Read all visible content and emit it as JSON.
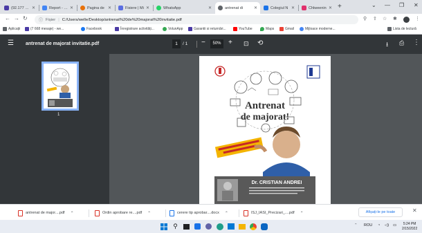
{
  "tabs": [
    {
      "label": "(92.177 unr",
      "favicon_color": "#4a3aa5",
      "icon": "mail-icon"
    },
    {
      "label": "Report - ac",
      "favicon_color": "#4285f4",
      "icon": "doc-icon"
    },
    {
      "label": "Pagina de",
      "favicon_color": "#e8710a",
      "icon": "page-icon"
    },
    {
      "label": "Fisiere | Mi",
      "favicon_color": "#5b6ee1",
      "icon": "folder-icon"
    },
    {
      "label": "WhatsApp",
      "favicon_color": "#25d366",
      "icon": "whatsapp-icon"
    },
    {
      "label": "antrenat di",
      "favicon_color": "#5f6368",
      "icon": "globe-icon"
    },
    {
      "label": "Colegiul N",
      "favicon_color": "#1a73e8",
      "icon": "school-icon"
    },
    {
      "label": "Chlweenin",
      "favicon_color": "#e1306c",
      "icon": "instagram-icon"
    }
  ],
  "active_tab_index": 5,
  "omnibox": {
    "label": "Fișier",
    "url": "C:/Users/welle/Desktop/antrenat%20de%20majorat%20invitatie.pdf"
  },
  "bookmarks": [
    {
      "label": "Aplicații",
      "color": "#5f6368"
    },
    {
      "label": "(7 668 mesaje) - we...",
      "color": "#4a3aa5"
    },
    {
      "label": "Facebook",
      "color": "#1877f2"
    },
    {
      "label": "Înregistrare activități...",
      "color": "#4a3aa5"
    },
    {
      "label": "VolunApp",
      "color": "#34a853"
    },
    {
      "label": "Garantii si returnări...",
      "color": "#4a3aa5"
    },
    {
      "label": "YouTube",
      "color": "#ff0000"
    },
    {
      "label": "Maps",
      "color": "#34a853"
    },
    {
      "label": "Gmail",
      "color": "#ea4335"
    },
    {
      "label": "Mijloace moderne...",
      "color": "#4285f4"
    }
  ],
  "reading_list": "Lista de lectură",
  "pdf": {
    "title": "antrenat de majorat invitatie.pdf",
    "page_current": "1",
    "page_total": "/ 1",
    "zoom": "50%",
    "thumb_number": "1",
    "page_content": {
      "headline_line1": "Antrenat",
      "headline_line2": "de majorat!",
      "speaker_title": "Dr. CRISTIAN ANDREI"
    }
  },
  "downloads": [
    {
      "label": "antrenat de major....pdf",
      "kind": "pdf"
    },
    {
      "label": "Ordin aprobare re....pdf",
      "kind": "pdf"
    },
    {
      "label": "cerere tip aprobar....docx",
      "kind": "doc"
    },
    {
      "label": "ISJ_IASI_Precizari_....pdf",
      "kind": "pdf"
    }
  ],
  "show_all": "Afișați-le pe toate",
  "tray": {
    "lang": "ROU",
    "time": "5:24 PM",
    "date": "2/15/2022"
  }
}
